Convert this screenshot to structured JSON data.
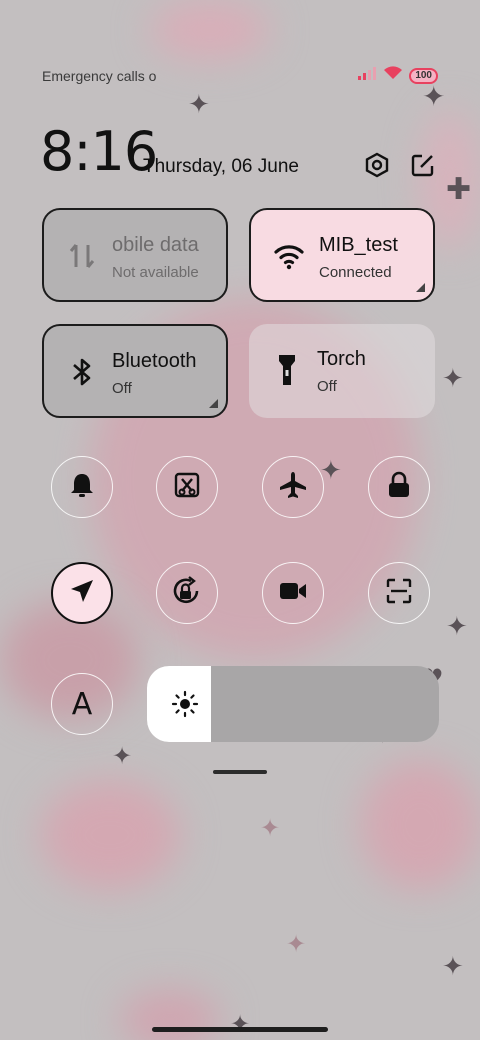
{
  "status_bar": {
    "text": "Emergency calls o",
    "battery": "100",
    "icons": [
      "signal-icon",
      "wifi-icon",
      "battery-icon"
    ]
  },
  "header": {
    "time": "8:16",
    "date": "Thursday, 06 June",
    "icons": [
      "settings-icon",
      "edit-icon"
    ]
  },
  "tiles": [
    {
      "title": "obile data",
      "subtitle": "Not available",
      "icon": "mobile-data-icon",
      "state": "unavailable"
    },
    {
      "title": "MIB_test",
      "subtitle": "Connected",
      "icon": "wifi-icon",
      "state": "on"
    },
    {
      "title": "Bluetooth",
      "subtitle": "Off",
      "icon": "bluetooth-icon",
      "state": "off"
    },
    {
      "title": "Torch",
      "subtitle": "Off",
      "icon": "torch-icon",
      "state": "off"
    }
  ],
  "toggles": [
    {
      "icon": "bell-icon",
      "active": false
    },
    {
      "icon": "screenshot-icon",
      "active": false
    },
    {
      "icon": "airplane-icon",
      "active": false
    },
    {
      "icon": "lock-icon",
      "active": false
    },
    {
      "icon": "location-icon",
      "active": true
    },
    {
      "icon": "rotation-lock-icon",
      "active": false
    },
    {
      "icon": "video-camera-icon",
      "active": false
    },
    {
      "icon": "scanner-icon",
      "active": false
    },
    {
      "icon": "font-icon",
      "active": false
    }
  ],
  "font_toggle_label": "A",
  "brightness": {
    "level": 0.22,
    "icon": "sun-icon"
  },
  "colors": {
    "accent_pink": "#f8dbe2",
    "battery": "#e8415f",
    "tile_off": "#b4b2b3"
  }
}
